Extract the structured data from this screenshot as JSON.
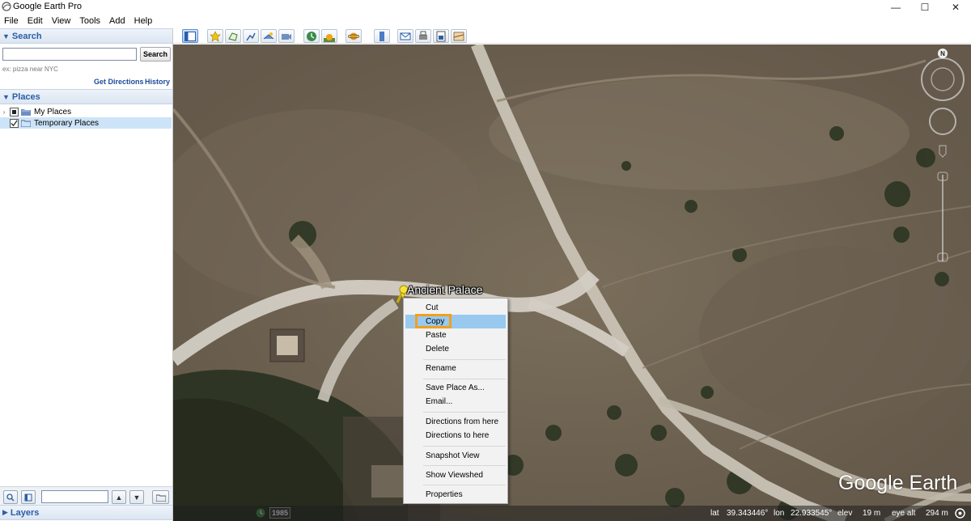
{
  "window": {
    "title": "Google Earth Pro",
    "controls": {
      "minimize": "—",
      "maximize": "☐",
      "close": "✕"
    }
  },
  "menu": [
    "File",
    "Edit",
    "View",
    "Tools",
    "Add",
    "Help"
  ],
  "search": {
    "header": "Search",
    "input_value": "",
    "button_label": "Search",
    "hint": "ex: pizza near NYC",
    "get_directions": "Get Directions",
    "history": "History"
  },
  "places": {
    "header": "Places",
    "items": [
      {
        "label": "My Places",
        "checked": "partial",
        "expander": "›"
      },
      {
        "label": "Temporary Places",
        "checked": "true",
        "selected": true
      }
    ]
  },
  "layers": {
    "header": "Layers"
  },
  "toolbar_icons": [
    "sidebar-toggle-icon",
    "add-placemark-icon",
    "add-polygon-icon",
    "add-path-icon",
    "add-image-overlay-icon",
    "record-tour-icon",
    "historical-imagery-icon",
    "sunlight-icon",
    "switch-planet-icon",
    "ruler-icon",
    "email-icon",
    "print-icon",
    "save-image-icon",
    "view-in-maps-icon"
  ],
  "map": {
    "placemark_label": "Ancient Palace",
    "watermark": "Google Earth",
    "compass_label": "N"
  },
  "context_menu": {
    "items": [
      {
        "label": "Cut"
      },
      {
        "label": "Copy",
        "highlighted": true
      },
      {
        "label": "Paste"
      },
      {
        "label": "Delete"
      },
      {
        "label": "Rename"
      },
      {
        "label": "Save Place As..."
      },
      {
        "label": "Email..."
      },
      {
        "label": "Directions from here"
      },
      {
        "label": "Directions to here"
      },
      {
        "label": "Snapshot View"
      },
      {
        "label": "Show Viewshed"
      },
      {
        "label": "Properties"
      }
    ]
  },
  "status": {
    "year": "1985",
    "lat_label": "lat",
    "lat_value": "39.343446°",
    "lon_label": "lon",
    "lon_value": "22.933545°",
    "elev_label": "elev",
    "elev_value": "19 m",
    "eye_alt_label": "eye alt",
    "eye_alt_value": "294 m"
  },
  "colors": {
    "accent": "#2a5ea8",
    "menu_highlight": "#99c9ef",
    "callout": "#f0a020",
    "selection": "#cde3f7"
  }
}
